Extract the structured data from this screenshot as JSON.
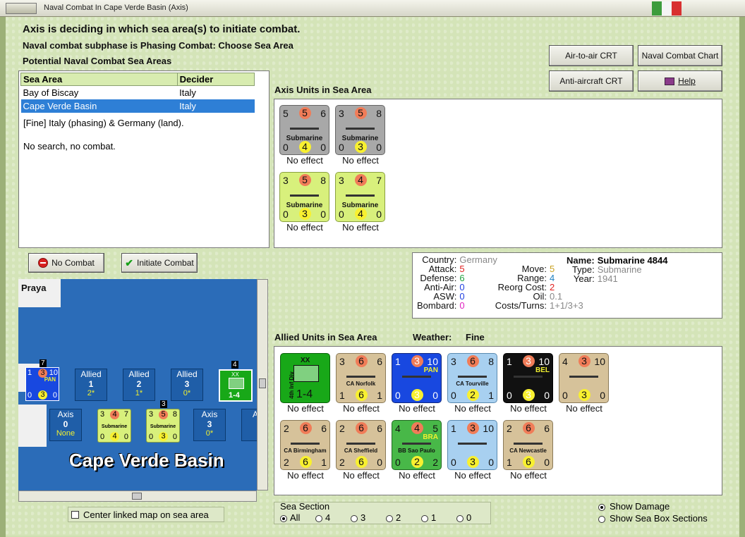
{
  "window": {
    "title": "Naval Combat In Cape Verde Basin (Axis)"
  },
  "headers": {
    "main": "Axis is deciding in which sea area(s) to initiate combat.",
    "subphase": "Naval combat subphase is Phasing Combat: Choose Sea Area",
    "potential": "Potential Naval Combat Sea Areas"
  },
  "buttons": {
    "air_crt": "Air-to-air CRT",
    "naval_chart": "Naval Combat Chart",
    "aa_crt": "Anti-aircraft CRT",
    "help": "Help",
    "no_combat": "No Combat",
    "initiate": "Initiate Combat"
  },
  "sea_table": {
    "headers": [
      "Sea Area",
      "Decider"
    ],
    "rows": [
      [
        "Bay of Biscay",
        "Italy"
      ],
      [
        "Cape Verde Basin",
        "Italy"
      ]
    ],
    "note1": "[Fine] Italy (phasing) & Germany (land).",
    "note2": "No search, no combat."
  },
  "axis_units": {
    "label": "Axis Units in Sea Area",
    "units": [
      {
        "tl": "5",
        "tc": "5",
        "tr": "6",
        "name": "Submarine",
        "bl": "0",
        "bc": "4",
        "br": "0",
        "effect": "No effect"
      },
      {
        "tl": "3",
        "tc": "5",
        "tr": "8",
        "name": "Submarine",
        "bl": "0",
        "bc": "3",
        "br": "0",
        "effect": "No effect"
      },
      {
        "tl": "3",
        "tc": "5",
        "tr": "8",
        "name": "Submarine",
        "bl": "0",
        "bc": "3",
        "br": "0",
        "effect": "No effect"
      },
      {
        "tl": "3",
        "tc": "4",
        "tr": "7",
        "name": "Submarine",
        "bl": "0",
        "bc": "4",
        "br": "0",
        "effect": "No effect"
      }
    ]
  },
  "info": {
    "country_k": "Country:",
    "country": "Germany",
    "attack_k": "Attack:",
    "attack": "5",
    "defense_k": "Defense:",
    "defense": "6",
    "aa_k": "Anti-Air:",
    "aa": "0",
    "asw_k": "ASW:",
    "asw": "0",
    "bombard_k": "Bombard:",
    "bombard": "0",
    "move_k": "Move:",
    "move": "5",
    "range_k": "Range:",
    "range": "4",
    "reorg_k": "Reorg Cost:",
    "reorg": "2",
    "oil_k": "Oil:",
    "oil": "0.1",
    "costs_k": "Costs/Turns:",
    "costs": "1+1/3+3",
    "name_k": "Name:",
    "name": "Submarine 4844",
    "type_k": "Type:",
    "type": "Submarine",
    "year_k": "Year:",
    "year": "1941"
  },
  "allied": {
    "label": "Allied Units in Sea Area",
    "weather_k": "Weather:",
    "weather": "Fine",
    "row1": [
      {
        "special": "army",
        "tag": "XX",
        "div": "4th Inf Div",
        "val": "1-4",
        "effect": "No effect"
      },
      {
        "tl": "3",
        "tc": "6",
        "tr": "6",
        "name": "CA Norfolk",
        "bl": "1",
        "bc": "6",
        "br": "1",
        "effect": "No effect"
      },
      {
        "tl": "1",
        "tc": "3",
        "tr": "10",
        "name": "",
        "flag": "PAN",
        "bl": "0",
        "bc": "3",
        "br": "0",
        "effect": "No effect"
      },
      {
        "tl": "3",
        "tc": "6",
        "tr": "8",
        "name": "CA Tourville",
        "bl": "0",
        "bc": "2",
        "br": "1",
        "effect": "No effect"
      },
      {
        "tl": "1",
        "tc": "3",
        "tr": "10",
        "name": "",
        "flag": "BEL",
        "bl": "0",
        "bc": "3",
        "br": "0",
        "effect": "No effect"
      },
      {
        "tl": "4",
        "tc": "3",
        "tr": "10",
        "name": "",
        "bl": "0",
        "bc": "3",
        "br": "0",
        "effect": "No effect"
      }
    ],
    "row2": [
      {
        "tl": "2",
        "tc": "6",
        "tr": "6",
        "name": "CA Birmingham",
        "bl": "2",
        "bc": "6",
        "br": "1",
        "effect": "No effect"
      },
      {
        "tl": "2",
        "tc": "6",
        "tr": "6",
        "name": "CA Sheffield",
        "bl": "2",
        "bc": "6",
        "br": "0",
        "effect": "No effect"
      },
      {
        "tl": "4",
        "tc": "4",
        "tr": "5",
        "name": "BB Sao Paulo",
        "flag": "BRA",
        "bl": "0",
        "bc": "2",
        "br": "2",
        "effect": "No effect"
      },
      {
        "tl": "1",
        "tc": "3",
        "tr": "10",
        "name": "",
        "bl": "0",
        "bc": "3",
        "br": "0",
        "effect": "No effect"
      },
      {
        "tl": "2",
        "tc": "6",
        "tr": "6",
        "name": "CA Newcastle",
        "bl": "1",
        "bc": "6",
        "br": "0",
        "effect": "No effect"
      }
    ]
  },
  "map": {
    "place": "Praya",
    "sea_name": "Cape Verde Basin",
    "allied_boxes": [
      {
        "title": "Allied",
        "n": "1",
        "s": "2*"
      },
      {
        "title": "Allied",
        "n": "2",
        "s": "1*"
      },
      {
        "title": "Allied",
        "n": "3",
        "s": "0*"
      }
    ],
    "axis_boxes": [
      {
        "title": "Axis",
        "n": "0",
        "s": "None"
      },
      {
        "title": "Axis",
        "n": "3",
        "s": "0*"
      },
      {
        "title": "Ax",
        "n": "",
        "s": ""
      }
    ],
    "stack_counts": [
      "7",
      "4",
      "3"
    ],
    "mini_flag": "PAN",
    "mini_army": "1-4",
    "mini_army_tag": "XX",
    "mini_sub1": {
      "tl": "3",
      "tc": "4",
      "tr": "7",
      "name": "Submarine",
      "bl": "0",
      "bc": "4",
      "br": "0"
    },
    "mini_sub2": {
      "tl": "3",
      "tc": "5",
      "tr": "8",
      "name": "Submarine",
      "bl": "0",
      "bc": "3",
      "br": "0"
    },
    "mini_ship": {
      "tl": "1",
      "tc": "3",
      "tr": "10",
      "bl": "0",
      "bc": "3",
      "br": "0"
    }
  },
  "center_link": "Center linked map on sea area",
  "sea_section": {
    "label": "Sea Section",
    "options": [
      "All",
      "4",
      "3",
      "2",
      "1",
      "0"
    ],
    "selected": "All"
  },
  "show": {
    "damage": "Show Damage",
    "boxes": "Show Sea Box Sections"
  }
}
